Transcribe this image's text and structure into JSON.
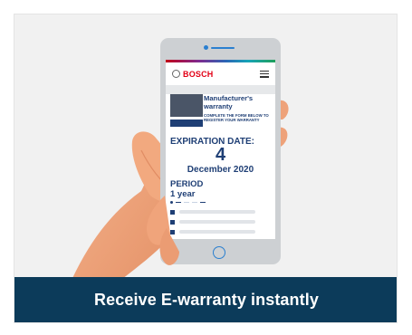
{
  "banner": {
    "text": "Receive E-warranty instantly"
  },
  "phone": {
    "brand": "BOSCH",
    "brand_color": "#e20015",
    "accent_color": "#2a7fd0",
    "menu_icon": "hamburger-menu-icon",
    "warranty": {
      "title": "Manufacturer's warranty",
      "instruction": "COMPLETE THE FORM BELOW TO REGISTER YOUR WARRANTY"
    },
    "expiration": {
      "label": "EXPIRATION DATE:",
      "day": "4",
      "month_year": "December 2020"
    },
    "period": {
      "label": "PERIOD",
      "value": "1 year"
    }
  },
  "colors": {
    "banner_bg": "#0c3b5a",
    "navy_text": "#1f3f75",
    "card_bg": "#f1f1f1"
  }
}
